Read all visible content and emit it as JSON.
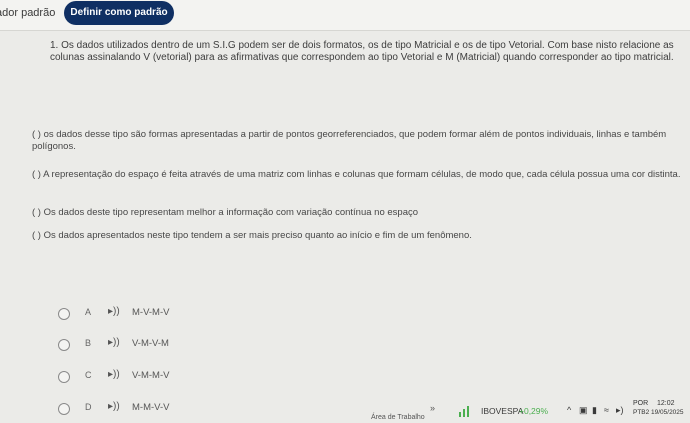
{
  "topbar": {
    "default_label": "ador padrão",
    "set_default_button": "Definir como padrão"
  },
  "question": {
    "number": "1.",
    "prompt": "Os dados utilizados dentro de um S.I.G podem ser de dois formatos, os de tipo Matricial e os de tipo Vetorial. Com base nisto relacione as colunas assinalando V (vetorial) para as afirmativas que correspondem ao tipo Vetorial e M (Matricial) quando corresponder ao tipo matricial.",
    "statements": [
      "( ) os dados desse tipo são formas apresentadas a partir de pontos georreferenciados, que podem formar além de pontos individuais, linhas e também polígonos.",
      "( ) A representação do espaço é feita através de uma matriz com linhas e colunas que formam células, de modo que, cada célula possua uma cor distinta.",
      "( ) Os dados deste tipo representam melhor a informação com variação contínua no espaço",
      "( ) Os dados apresentados neste tipo tendem a ser mais preciso quanto ao início e fim de um fenômeno."
    ],
    "options": [
      {
        "letter": "A",
        "text": "M-V-M-V"
      },
      {
        "letter": "B",
        "text": "V-M-V-M"
      },
      {
        "letter": "C",
        "text": "V-M-M-V"
      },
      {
        "letter": "D",
        "text": "M-M-V-V"
      }
    ],
    "speaker_icon": "speaker-icon"
  },
  "taskbar": {
    "work_area": "Área de Trabalho",
    "chevron": "»",
    "ticker_label": "IBOVESPA",
    "ticker_change": "+0,29%",
    "ticker_change_color": "#4caf50",
    "lang_1": "POR",
    "lang_2": "PTB2",
    "time": "12:02",
    "date": "19/05/2025"
  }
}
